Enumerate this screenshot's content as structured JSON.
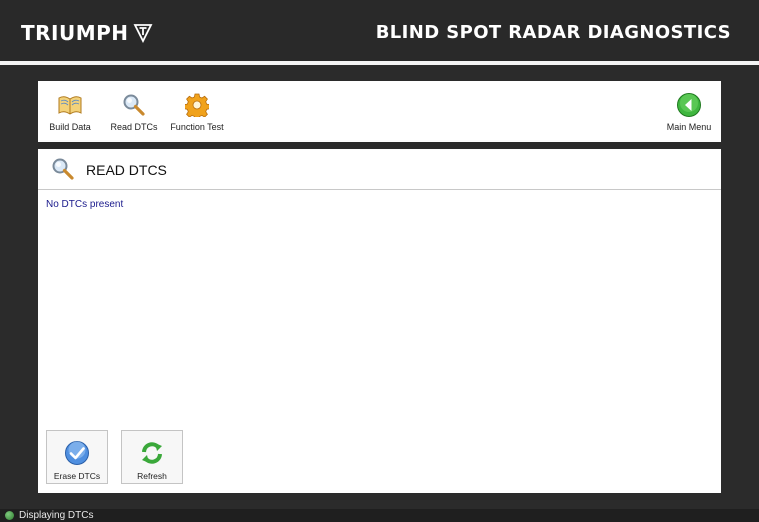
{
  "header": {
    "brand": "TRIUMPH",
    "title": "BLIND SPOT RADAR DIAGNOSTICS"
  },
  "toolbar": {
    "build_data": "Build Data",
    "read_dtcs": "Read DTCs",
    "function_test": "Function Test",
    "main_menu": "Main Menu"
  },
  "panel": {
    "title": "READ DTCS",
    "message": "No DTCs present",
    "erase_label": "Erase DTCs",
    "refresh_label": "Refresh"
  },
  "statusbar": {
    "text": "Displaying DTCs"
  },
  "icons": {
    "build_data": "open-book-icon",
    "read_dtcs": "magnifier-icon",
    "function_test": "gear-icon",
    "main_menu": "back-arrow-icon",
    "erase": "checkmark-icon",
    "refresh": "refresh-icon"
  },
  "colors": {
    "background": "#2b2b2b",
    "message_text": "#1a1a8c",
    "status_ok": "#3a9a3a"
  }
}
